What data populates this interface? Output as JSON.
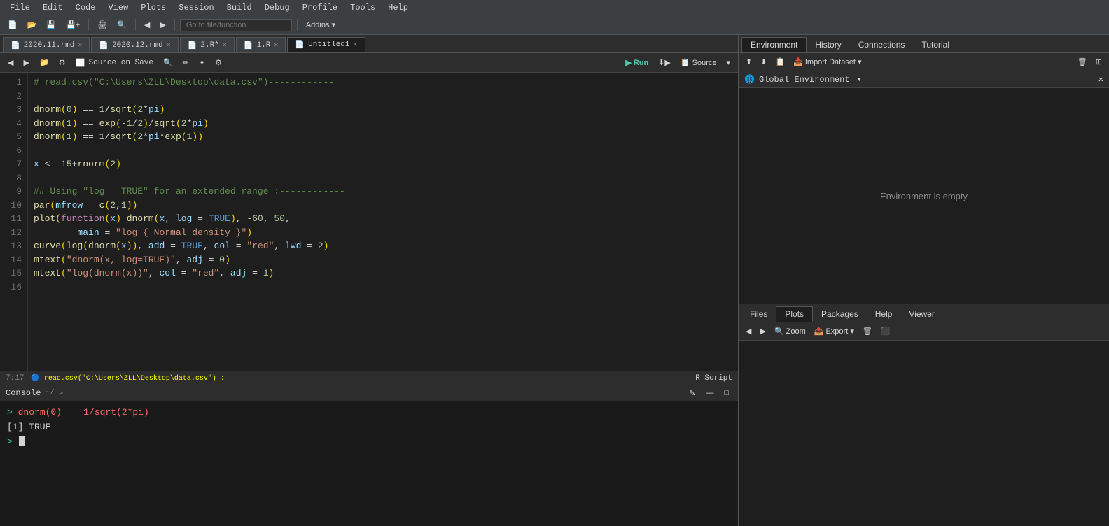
{
  "menu": {
    "items": [
      "File",
      "Edit",
      "Code",
      "View",
      "Plots",
      "Session",
      "Build",
      "Debug",
      "Profile",
      "Tools",
      "Help"
    ]
  },
  "toolbar": {
    "goto_placeholder": "Go to file/function",
    "addins_label": "Addins ▾"
  },
  "tabs": [
    {
      "id": "tab1",
      "label": "2020.11.rmd",
      "icon": "📄",
      "active": false
    },
    {
      "id": "tab2",
      "label": "2020.12.rmd",
      "icon": "📄",
      "active": false
    },
    {
      "id": "tab3",
      "label": "2.R*",
      "icon": "📄",
      "active": false
    },
    {
      "id": "tab4",
      "label": "1.R",
      "icon": "📄",
      "active": false
    },
    {
      "id": "tab5",
      "label": "Untitled1",
      "icon": "📄",
      "active": true
    }
  ],
  "editor": {
    "run_label": "Run",
    "source_label": "Source",
    "source_on_save_label": "Source on Save",
    "lines": [
      {
        "num": 1,
        "content": "# read.csv(\"C:\\Users\\ZLL\\Desktop\\data.csv\")------------"
      },
      {
        "num": 2,
        "content": ""
      },
      {
        "num": 3,
        "content": "dnorm(0) == 1/sqrt(2*pi)"
      },
      {
        "num": 4,
        "content": "dnorm(1) == exp(-1/2)/sqrt(2*pi)"
      },
      {
        "num": 5,
        "content": "dnorm(1) == 1/sqrt(2*pi*exp(1))"
      },
      {
        "num": 6,
        "content": ""
      },
      {
        "num": 7,
        "content": "x <- 15+rnorm(2)"
      },
      {
        "num": 8,
        "content": ""
      },
      {
        "num": 9,
        "content": "## Using \"log = TRUE\" for an extended range :------------"
      },
      {
        "num": 10,
        "content": "par(mfrow = c(2,1))"
      },
      {
        "num": 11,
        "content": "plot(function(x) dnorm(x, log = TRUE), -60, 50,"
      },
      {
        "num": 12,
        "content": "        main = \"log { Normal density }\")"
      },
      {
        "num": 13,
        "content": "curve(log(dnorm(x)), add = TRUE, col = \"red\", lwd = 2)"
      },
      {
        "num": 14,
        "content": "mtext(\"dnorm(x, log=TRUE)\", adj = 0)"
      },
      {
        "num": 15,
        "content": "mtext(\"log(dnorm(x))\", col = \"red\", adj = 1)"
      },
      {
        "num": 16,
        "content": ""
      }
    ],
    "status": {
      "position": "7:17",
      "file_path": "read.csv(\"C:\\Users\\ZLL\\Desktop\\data.csv\") :",
      "script_type": "R Script"
    }
  },
  "console": {
    "title": "Console",
    "working_dir": "~/",
    "command": "dnorm(0) == 1/sqrt(2*pi)",
    "result": "[1] TRUE",
    "prompt": ">"
  },
  "right_panel": {
    "top_tabs": [
      {
        "label": "Environment",
        "active": true
      },
      {
        "label": "History",
        "active": false
      },
      {
        "label": "Connections",
        "active": false
      },
      {
        "label": "Tutorial",
        "active": false
      }
    ],
    "toolbar_buttons": [
      "⬆",
      "⬇",
      "📋"
    ],
    "import_label": "Import Dataset ▾",
    "global_env_label": "Global Environment",
    "empty_message": "Environment is empty",
    "bottom_tabs": [
      {
        "label": "Files",
        "active": false
      },
      {
        "label": "Plots",
        "active": true
      },
      {
        "label": "Packages",
        "active": false
      },
      {
        "label": "Help",
        "active": false
      },
      {
        "label": "Viewer",
        "active": false
      }
    ],
    "plots_toolbar": {
      "back_label": "◀",
      "forward_label": "▶",
      "zoom_label": "Zoom",
      "export_label": "Export ▾",
      "delete_label": "🗑",
      "clear_label": "⬛"
    }
  }
}
